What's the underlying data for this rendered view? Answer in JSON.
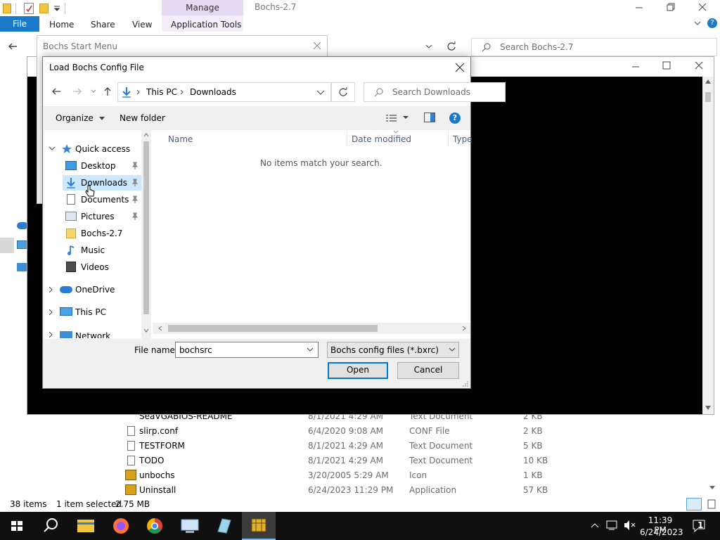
{
  "explorer": {
    "title": "Bochs-2.7",
    "ribbon": {
      "file": "File",
      "home": "Home",
      "share": "Share",
      "view": "View",
      "manage": "Manage",
      "app_tools": "Application Tools"
    },
    "search_placeholder": "Search Bochs-2.7",
    "files": [
      {
        "name": "SeaVGABIOS-README",
        "date": "8/1/2021 4:29 AM",
        "type": "Text Document",
        "size": "2 KB"
      },
      {
        "name": "slirp.conf",
        "date": "6/4/2020 9:08 AM",
        "type": "CONF File",
        "size": "2 KB"
      },
      {
        "name": "TESTFORM",
        "date": "8/1/2021 4:29 AM",
        "type": "Text Document",
        "size": "5 KB"
      },
      {
        "name": "TODO",
        "date": "8/1/2021 4:29 AM",
        "type": "Text Document",
        "size": "10 KB"
      },
      {
        "name": "unbochs",
        "date": "3/20/2005 5:29 AM",
        "type": "Icon",
        "size": "1 KB"
      },
      {
        "name": "Uninstall",
        "date": "6/24/2023 11:29 PM",
        "type": "Application",
        "size": "57 KB"
      }
    ],
    "status": {
      "items": "38 items",
      "selected": "1 item selected",
      "size": "2.75 MB"
    }
  },
  "start_menu": {
    "title": "Bochs Start Menu"
  },
  "dialog": {
    "title": "Load Bochs Config File",
    "breadcrumb": [
      "This PC",
      "Downloads"
    ],
    "search_placeholder": "Search Downloads",
    "toolbar": {
      "organize": "Organize",
      "new_folder": "New folder"
    },
    "columns": {
      "name": "Name",
      "date": "Date modified",
      "type": "Type"
    },
    "empty_message": "No items match your search.",
    "nav": {
      "quick_access": "Quick access",
      "items": [
        "Desktop",
        "Downloads",
        "Documents",
        "Pictures",
        "Bochs-2.7",
        "Music",
        "Videos"
      ],
      "onedrive": "OneDrive",
      "this_pc": "This PC",
      "network": "Network"
    },
    "file_name_label": "File name:",
    "file_name_value": "bochsrc",
    "file_type": "Bochs config files (*.bxrc)",
    "open": "Open",
    "cancel": "Cancel"
  },
  "taskbar": {
    "time": "11:39 PM",
    "date": "6/24/2023",
    "notification_count": "1"
  },
  "colors": {
    "accent": "#0078d7",
    "file_tab": "#1979ca",
    "manage_band": "#e6d9f4",
    "selected_nav": "#cce8ff",
    "taskbar": "#101010"
  }
}
